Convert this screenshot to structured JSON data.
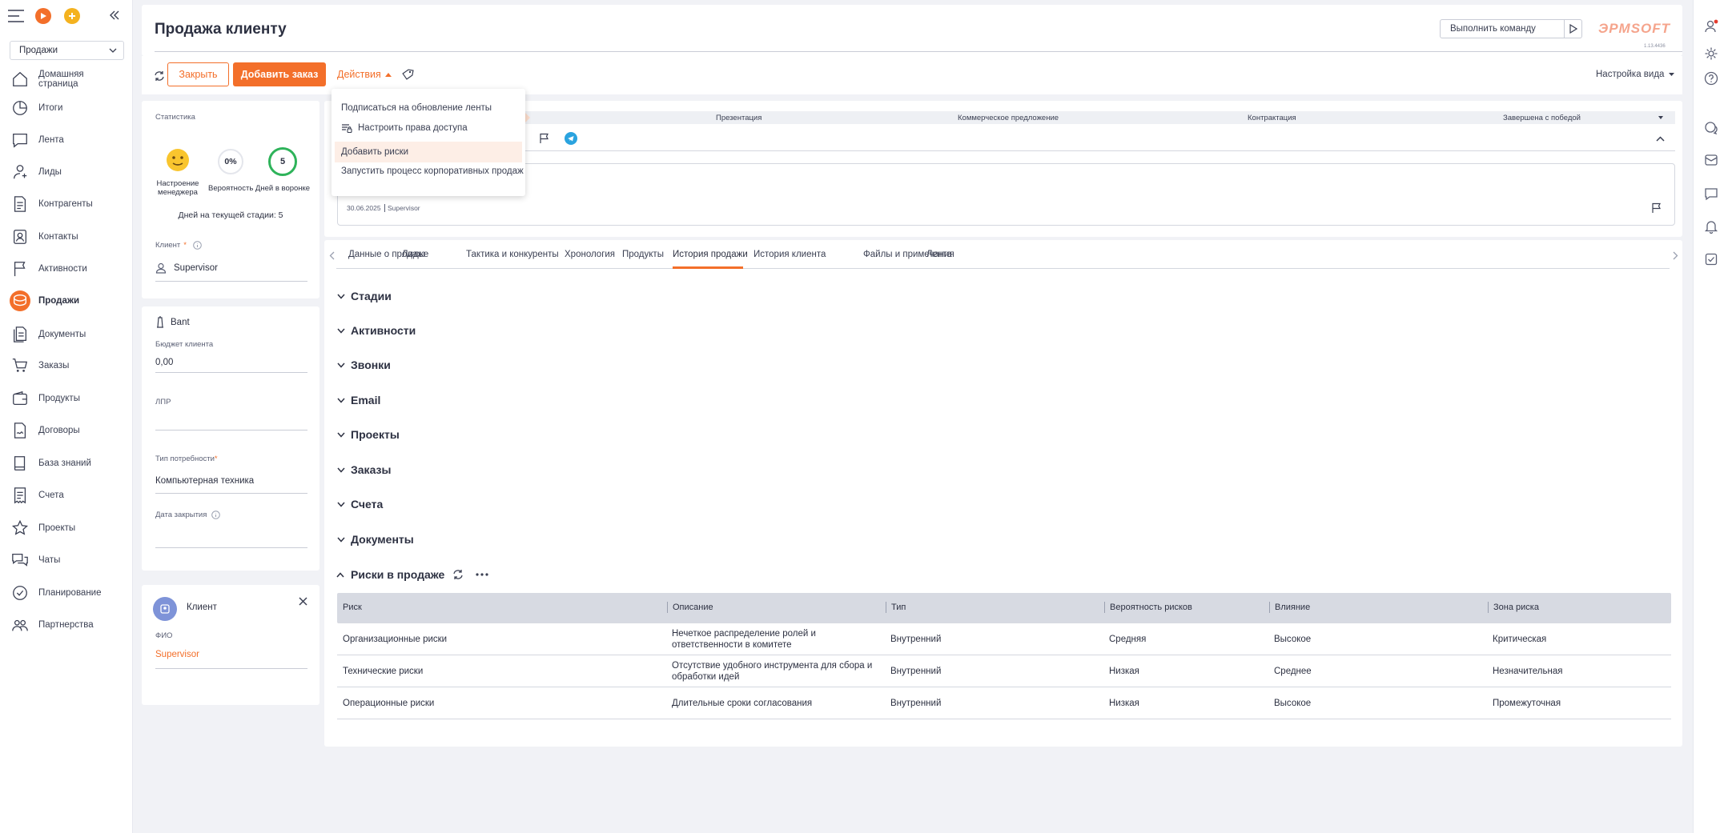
{
  "sidebar": {
    "dropdown_value": "Продажи",
    "items": [
      {
        "label": "Домашняя страница",
        "icon": "home-icon"
      },
      {
        "label": "Итоги",
        "icon": "pie-chart-icon"
      },
      {
        "label": "Лента",
        "icon": "chat-bubble-icon"
      },
      {
        "label": "Лиды",
        "icon": "lead-icon"
      },
      {
        "label": "Контрагенты",
        "icon": "document-icon"
      },
      {
        "label": "Контакты",
        "icon": "contact-icon"
      },
      {
        "label": "Активности",
        "icon": "flag-icon"
      },
      {
        "label": "Продажи",
        "icon": "coins-icon"
      },
      {
        "label": "Документы",
        "icon": "documents-icon"
      },
      {
        "label": "Заказы",
        "icon": "cart-icon"
      },
      {
        "label": "Продукты",
        "icon": "wallet-icon"
      },
      {
        "label": "Договоры",
        "icon": "contract-icon"
      },
      {
        "label": "База знаний",
        "icon": "book-icon"
      },
      {
        "label": "Счета",
        "icon": "invoice-icon"
      },
      {
        "label": "Проекты",
        "icon": "star-icon"
      },
      {
        "label": "Чаты",
        "icon": "chats-icon"
      },
      {
        "label": "Планирование",
        "icon": "check-circle-icon"
      },
      {
        "label": "Партнерства",
        "icon": "partners-icon"
      }
    ]
  },
  "header": {
    "title": "Продажа клиенту",
    "command_placeholder": "Выполнить команду",
    "logo_text": "ЭРМSOFT",
    "version": "1.13.4436",
    "view_settings": "Настройка вида"
  },
  "toolbar": {
    "close_label": "Закрыть",
    "add_order_label": "Добавить заказ",
    "actions_label": "Действия"
  },
  "actions_menu": [
    "Подписаться на обновление ленты",
    "Настроить права доступа",
    "Добавить риски",
    "Запустить процесс корпоративных продаж"
  ],
  "stats": {
    "title": "Статистика",
    "manager_mood_label": "Настроение менеджера",
    "probability_value": "0%",
    "probability_label": "Вероятность",
    "days_value": "5",
    "days_label": "Дней в воронке",
    "days_on_stage": "Дней на текущей стадии: 5",
    "client_label": "Клиент",
    "client_value": "Supervisor"
  },
  "bant": {
    "title": "Bant",
    "budget_label": "Бюджет клиента",
    "budget_value": "0,00",
    "lpr_label": "ЛПР",
    "need_type_label": "Тип потребности",
    "need_type_value": "Компьютерная техника",
    "close_date_label": "Дата закрытия"
  },
  "client_card": {
    "title": "Клиент",
    "fio_label": "ФИО",
    "fio_value": "Supervisor"
  },
  "stages": [
    "Презентация",
    "Коммерческое предложение",
    "Контрактация",
    "Завершена с победой"
  ],
  "feed": {
    "date": "30.06.2025",
    "author": "Supervisor"
  },
  "tabs": [
    "Данные о продаже",
    "Лиды",
    "Тактика и конкуренты",
    "Хронология",
    "Продукты",
    "История продажи",
    "История клиента",
    "Файлы и примечания",
    "Лента"
  ],
  "active_tab": "История продажи",
  "sections": [
    "Стадии",
    "Активности",
    "Звонки",
    "Email",
    "Проекты",
    "Заказы",
    "Счета",
    "Документы"
  ],
  "risks": {
    "title": "Риски в продаже",
    "columns": [
      "Риск",
      "Описание",
      "Тип",
      "Вероятность рисков",
      "Влияние",
      "Зона риска"
    ],
    "rows": [
      [
        "Организационные риски",
        "Нечеткое распределение ролей и ответственности в комитете",
        "Внутренний",
        "Средняя",
        "Высокое",
        "Критическая"
      ],
      [
        "Технические риски",
        "Отсутствие удобного инструмента для сбора и обработки идей",
        "Внутренний",
        "Низкая",
        "Среднее",
        "Незначительная"
      ],
      [
        "Операционные риски",
        "Длительные сроки согласования",
        "Внутренний",
        "Низкая",
        "Высокое",
        "Промежуточная"
      ]
    ]
  },
  "colors": {
    "accent": "#f36f2a",
    "telegram": "#2aa3df",
    "green": "#2eb35a"
  }
}
